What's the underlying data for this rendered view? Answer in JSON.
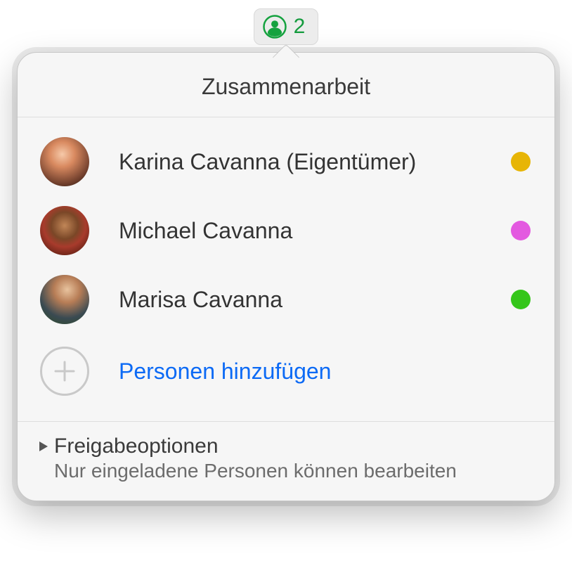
{
  "collab_button": {
    "count": "2"
  },
  "popover": {
    "title": "Zusammenarbeit"
  },
  "participants": [
    {
      "name": "Karina Cavanna (Eigentümer)",
      "color": "#e7b506"
    },
    {
      "name": "Michael Cavanna",
      "color": "#e359e0"
    },
    {
      "name": "Marisa Cavanna",
      "color": "#35c61a"
    }
  ],
  "add_people": {
    "label": "Personen hinzufügen"
  },
  "share_options": {
    "title": "Freigabeoptionen",
    "subtitle": "Nur eingeladene Personen können bearbeiten"
  }
}
